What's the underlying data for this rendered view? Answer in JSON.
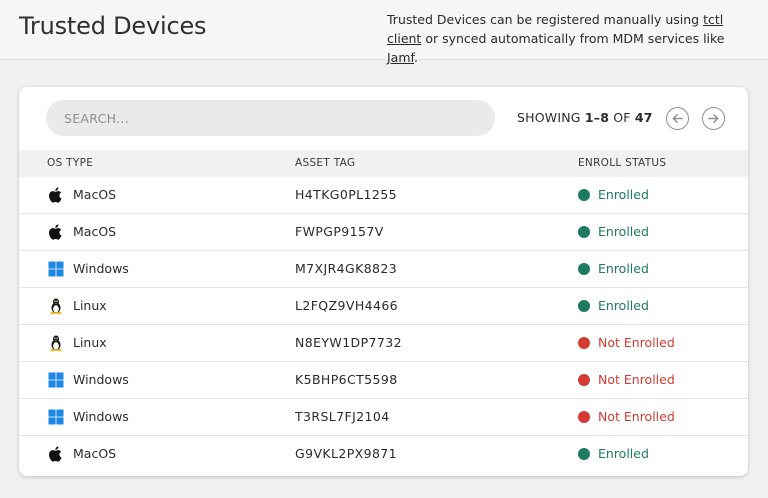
{
  "header": {
    "title": "Trusted Devices",
    "desc_part1": "Trusted Devices can be registered manually using ",
    "link1": "tctl client",
    "desc_part2": " or synced automatically from MDM services like ",
    "link2": "Jamf",
    "desc_part3": "."
  },
  "search": {
    "placeholder": "SEARCH..."
  },
  "pagination": {
    "prefix": "SHOWING ",
    "range": "1–8",
    "of": " OF ",
    "total": "47",
    "prev_icon": "arrow-left-icon",
    "next_icon": "arrow-right-icon"
  },
  "table": {
    "headers": {
      "os_type": "OS TYPE",
      "asset_tag": "ASSET TAG",
      "enroll_status": "ENROLL STATUS"
    },
    "rows": [
      {
        "os": "MacOS",
        "icon": "apple-icon",
        "asset": "H4TKG0PL1255",
        "status": "Enrolled",
        "enrolled": true
      },
      {
        "os": "MacOS",
        "icon": "apple-icon",
        "asset": "FWPGP9157V",
        "status": "Enrolled",
        "enrolled": true
      },
      {
        "os": "Windows",
        "icon": "windows-icon",
        "asset": "M7XJR4GK8823",
        "status": "Enrolled",
        "enrolled": true
      },
      {
        "os": "Linux",
        "icon": "linux-icon",
        "asset": "L2FQZ9VH4466",
        "status": "Enrolled",
        "enrolled": true
      },
      {
        "os": "Linux",
        "icon": "linux-icon",
        "asset": "N8EYW1DP7732",
        "status": "Not Enrolled",
        "enrolled": false
      },
      {
        "os": "Windows",
        "icon": "windows-icon",
        "asset": "K5BHP6CT5598",
        "status": "Not Enrolled",
        "enrolled": false
      },
      {
        "os": "Windows",
        "icon": "windows-icon",
        "asset": "T3RSL7FJ2104",
        "status": "Not Enrolled",
        "enrolled": false
      },
      {
        "os": "MacOS",
        "icon": "apple-icon",
        "asset": "G9VKL2PX9871",
        "status": "Enrolled",
        "enrolled": true
      }
    ]
  },
  "colors": {
    "enrolled": "#1f7a62",
    "not_enrolled": "#d43b32",
    "windows": "#1e88e5"
  }
}
